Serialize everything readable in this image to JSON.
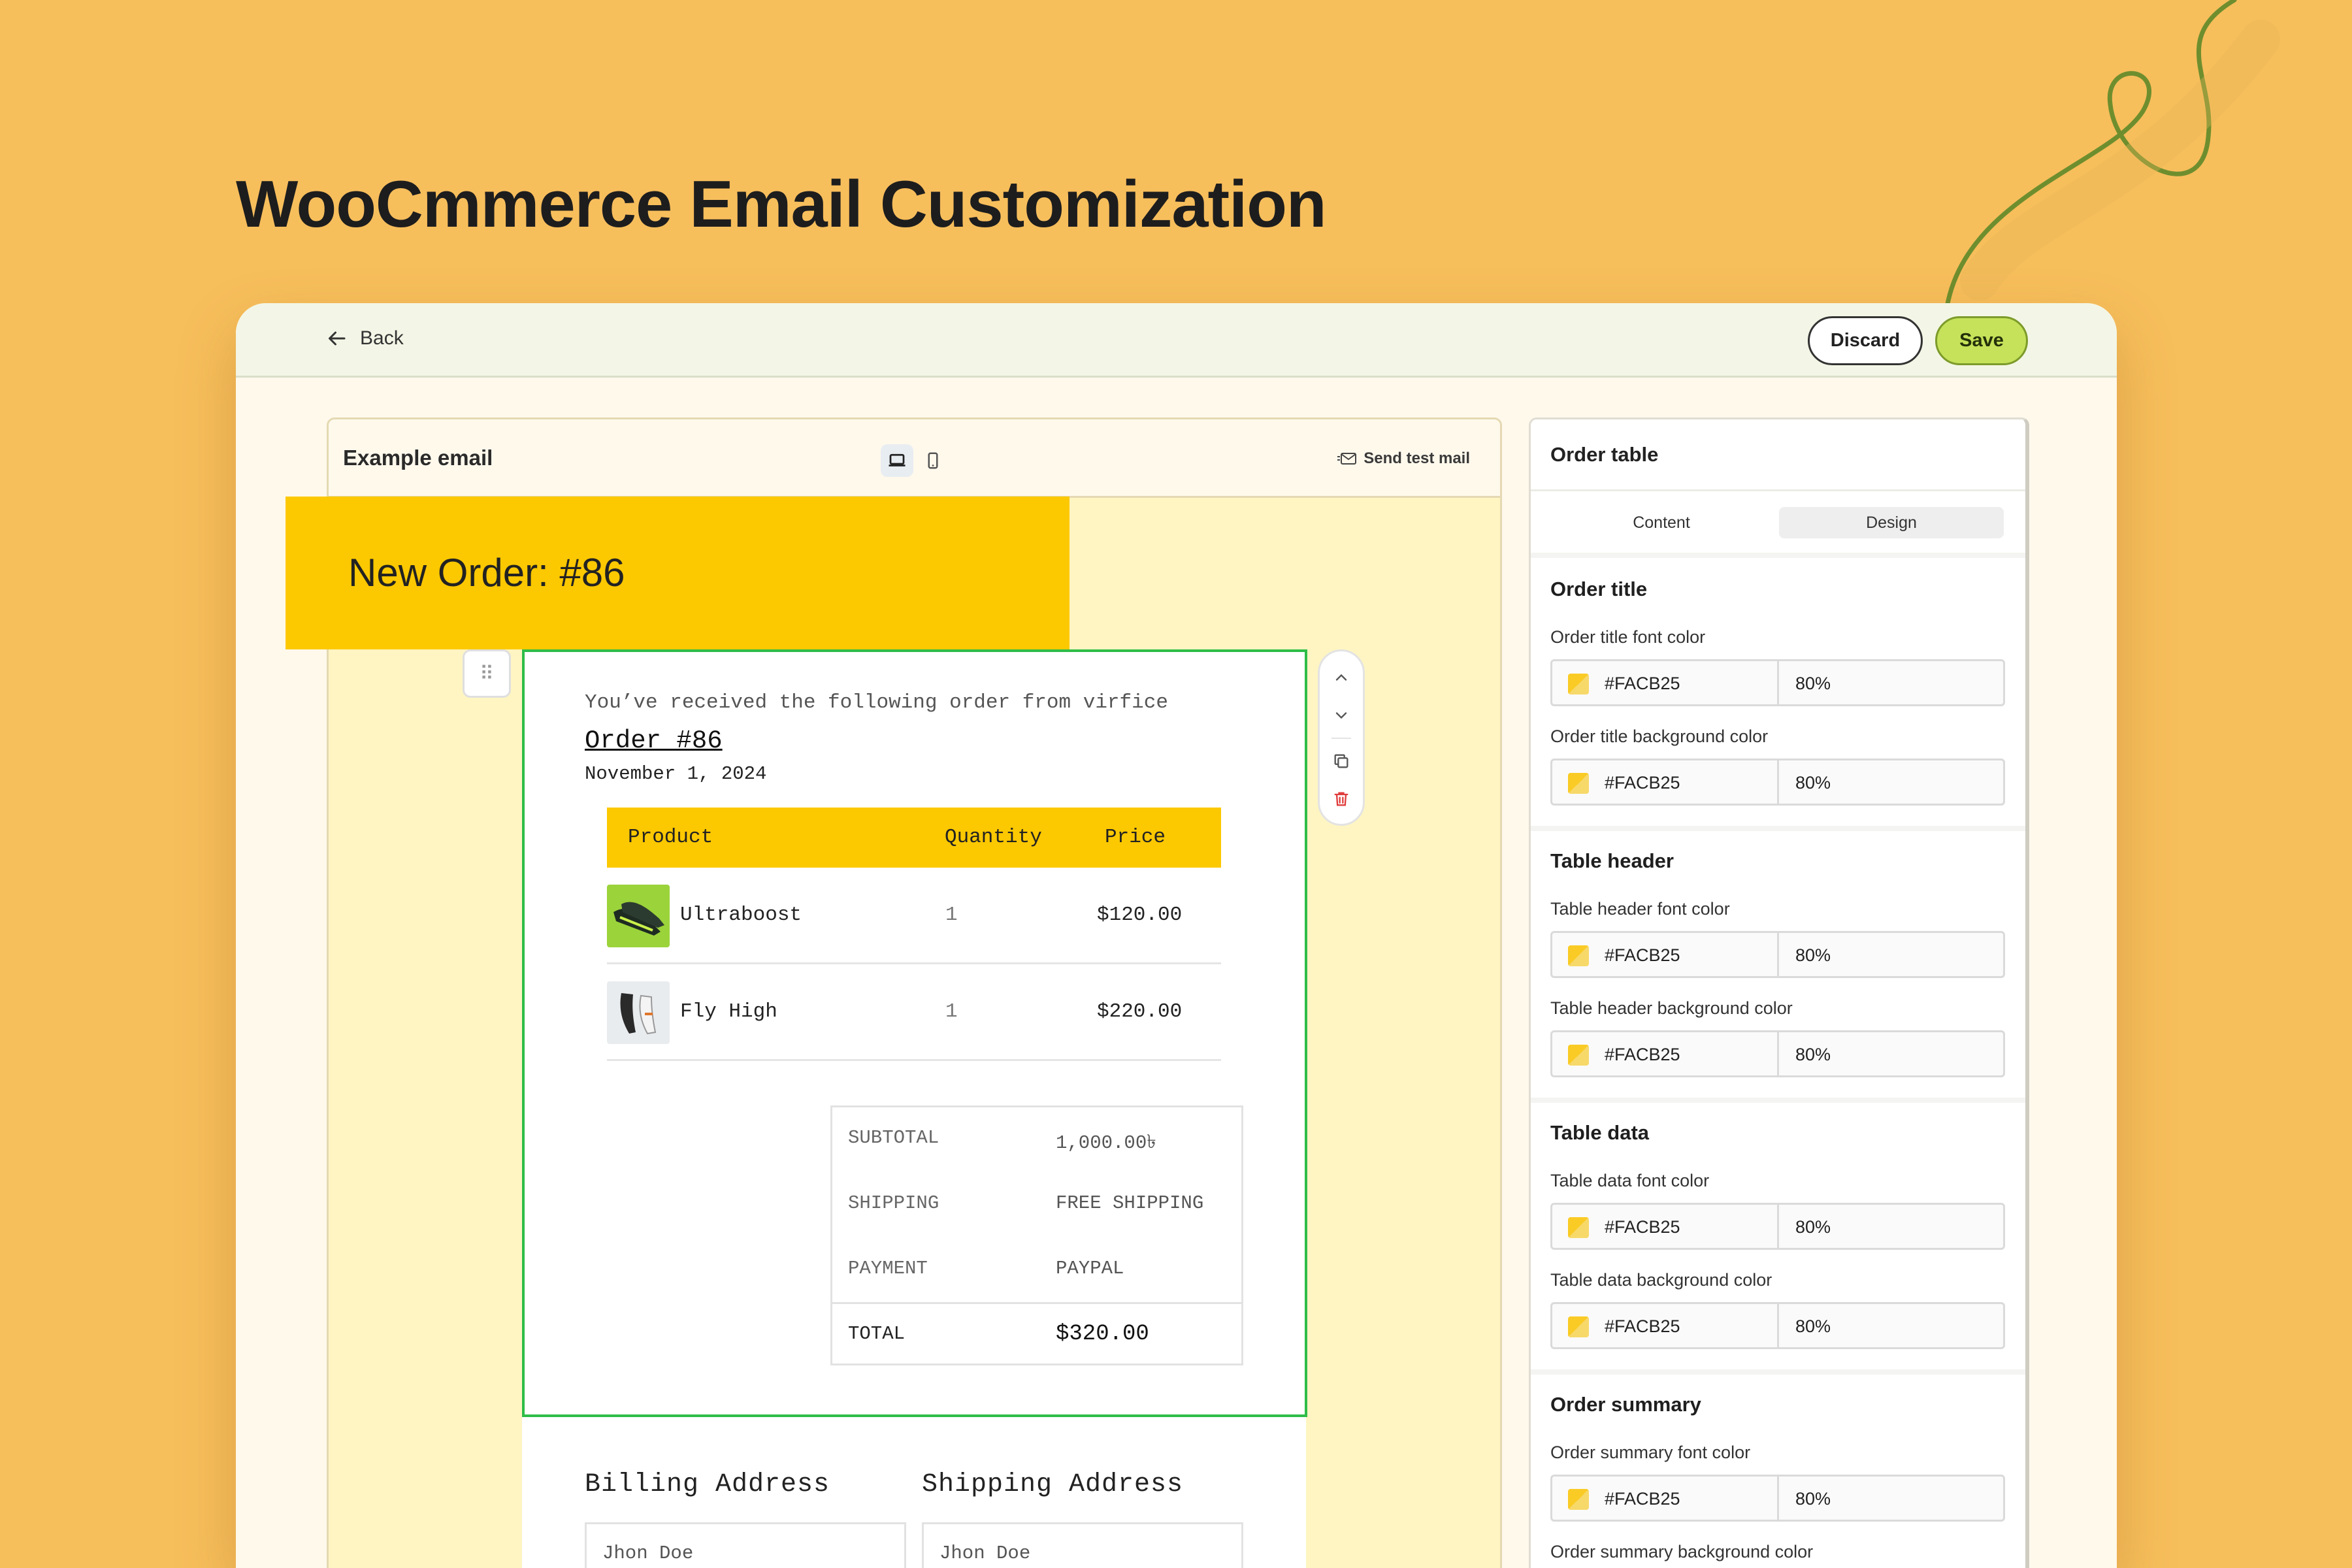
{
  "heading": "WooCmmerce Email Customization",
  "topbar": {
    "back_label": "Back",
    "discard_label": "Discard",
    "save_label": "Save"
  },
  "preview": {
    "title": "Example email",
    "send_test_label": "Send test mail",
    "email": {
      "header_title": "New Order: #86",
      "intro": "You’ve received the following order from virfice",
      "order_link": "Order #86",
      "order_date": "November 1, 2024",
      "table_headers": {
        "product": "Product",
        "quantity": "Quantity",
        "price": "Price"
      },
      "rows": [
        {
          "product": "Ultraboost",
          "quantity": "1",
          "price": "$120.00"
        },
        {
          "product": "Fly High",
          "quantity": "1",
          "price": "$220.00"
        }
      ],
      "summary": {
        "subtotal_label": "SUBTOTAL",
        "subtotal_value": "1,000.00৳",
        "shipping_label": "SHIPPING",
        "shipping_value": "FREE SHIPPING",
        "payment_label": "PAYMENT",
        "payment_value": "PAYPAL",
        "total_label": "TOTAL",
        "total_value": "$320.00"
      },
      "billing_heading": "Billing Address",
      "shipping_heading": "Shipping Address",
      "billing_name": "Jhon Doe",
      "shipping_name": "Jhon Doe"
    }
  },
  "panel": {
    "title": "Order table",
    "tabs": {
      "content": "Content",
      "design": "Design"
    },
    "sections": [
      {
        "title": "Order title",
        "fields": [
          {
            "label": "Order title font color",
            "hex": "#FACB25",
            "opacity": "80%"
          },
          {
            "label": "Order title background color",
            "hex": "#FACB25",
            "opacity": "80%"
          }
        ]
      },
      {
        "title": "Table header",
        "fields": [
          {
            "label": "Table header font color",
            "hex": "#FACB25",
            "opacity": "80%"
          },
          {
            "label": "Table header background color",
            "hex": "#FACB25",
            "opacity": "80%"
          }
        ]
      },
      {
        "title": "Table data",
        "fields": [
          {
            "label": "Table data font color",
            "hex": "#FACB25",
            "opacity": "80%"
          },
          {
            "label": "Table data background color",
            "hex": "#FACB25",
            "opacity": "80%"
          }
        ]
      },
      {
        "title": "Order summary",
        "fields": [
          {
            "label": "Order summary font color",
            "hex": "#FACB25",
            "opacity": "80%"
          },
          {
            "label": "Order summary background color"
          }
        ]
      }
    ]
  },
  "colors": {
    "page_background": "#F7BE5C",
    "email_header": "#FCC800",
    "selection_border": "#2EBD48",
    "save_button": "#C5E25A",
    "preview_canvas": "#FFF5C2",
    "swatch": "#FACB25"
  },
  "icons": [
    "arrow-left-icon",
    "desktop-icon",
    "mobile-icon",
    "send-mail-icon",
    "drag-handle-icon",
    "chevron-up-icon",
    "chevron-down-icon",
    "duplicate-icon",
    "trash-icon",
    "color-swatch-icon"
  ]
}
